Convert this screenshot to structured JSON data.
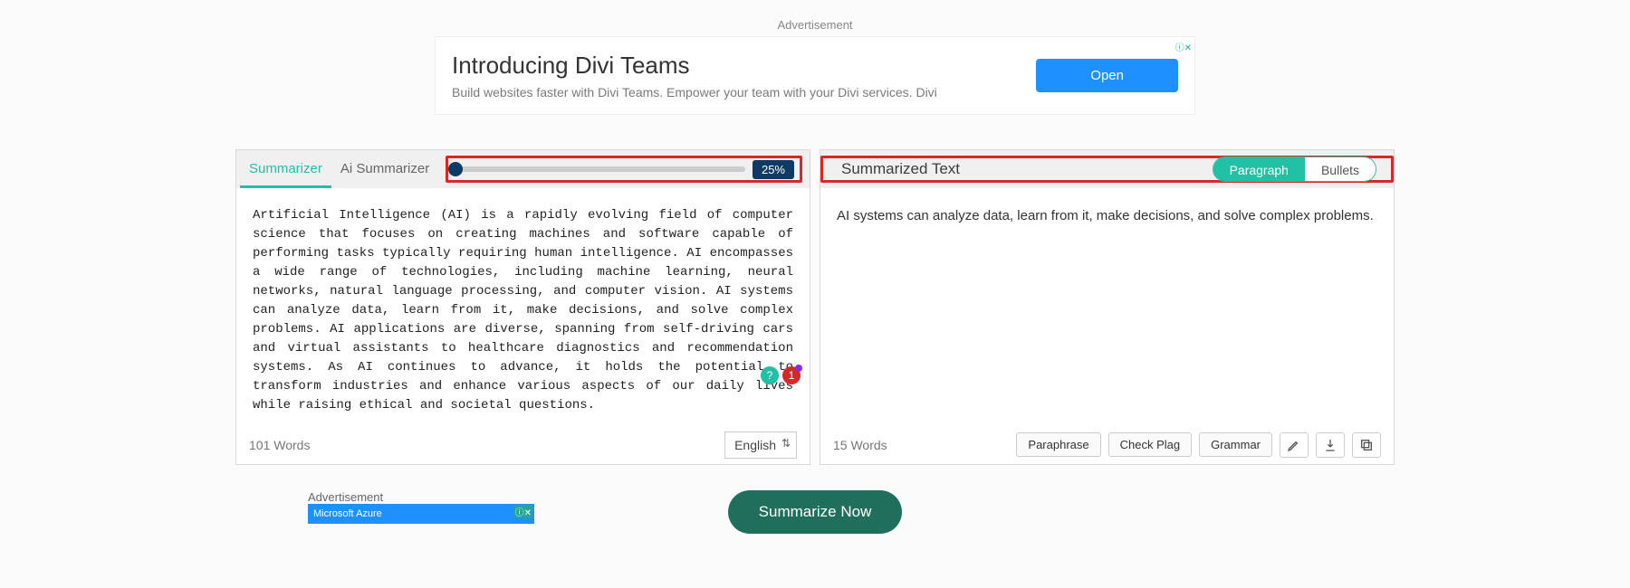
{
  "ad_top": {
    "label": "Advertisement",
    "title": "Introducing Divi Teams",
    "subtitle": "Build websites faster with Divi Teams. Empower your team with your Divi services. Divi",
    "cta": "Open"
  },
  "left_panel": {
    "tabs": {
      "summarizer": "Summarizer",
      "ai_summarizer": "Ai Summarizer"
    },
    "slider_value": "25%",
    "text": "Artificial Intelligence (AI) is a rapidly evolving field of computer science that focuses on creating machines and software capable of performing tasks typically requiring human intelligence. AI encompasses a wide range of technologies, including machine learning, neural networks, natural language processing, and computer vision. AI systems can analyze data, learn from it, make decisions, and solve complex problems. AI applications are diverse, spanning from self-driving cars and virtual assistants to healthcare diagnostics and recommendation systems. As AI continues to advance, it holds the potential to transform industries and enhance various aspects of our daily lives while raising ethical and societal questions.",
    "word_count": "101 Words",
    "language": "English"
  },
  "right_panel": {
    "title": "Summarized Text",
    "toggle": {
      "paragraph": "Paragraph",
      "bullets": "Bullets"
    },
    "text": "AI systems can analyze data, learn from it, make decisions, and solve complex problems.",
    "word_count": "15 Words",
    "buttons": {
      "paraphrase": "Paraphrase",
      "check_plag": "Check Plag",
      "grammar": "Grammar"
    }
  },
  "cta": "Summarize Now",
  "ad_bottom": {
    "label": "Advertisement",
    "brand": "Microsoft Azure"
  },
  "float": {
    "red_badge": "1"
  }
}
